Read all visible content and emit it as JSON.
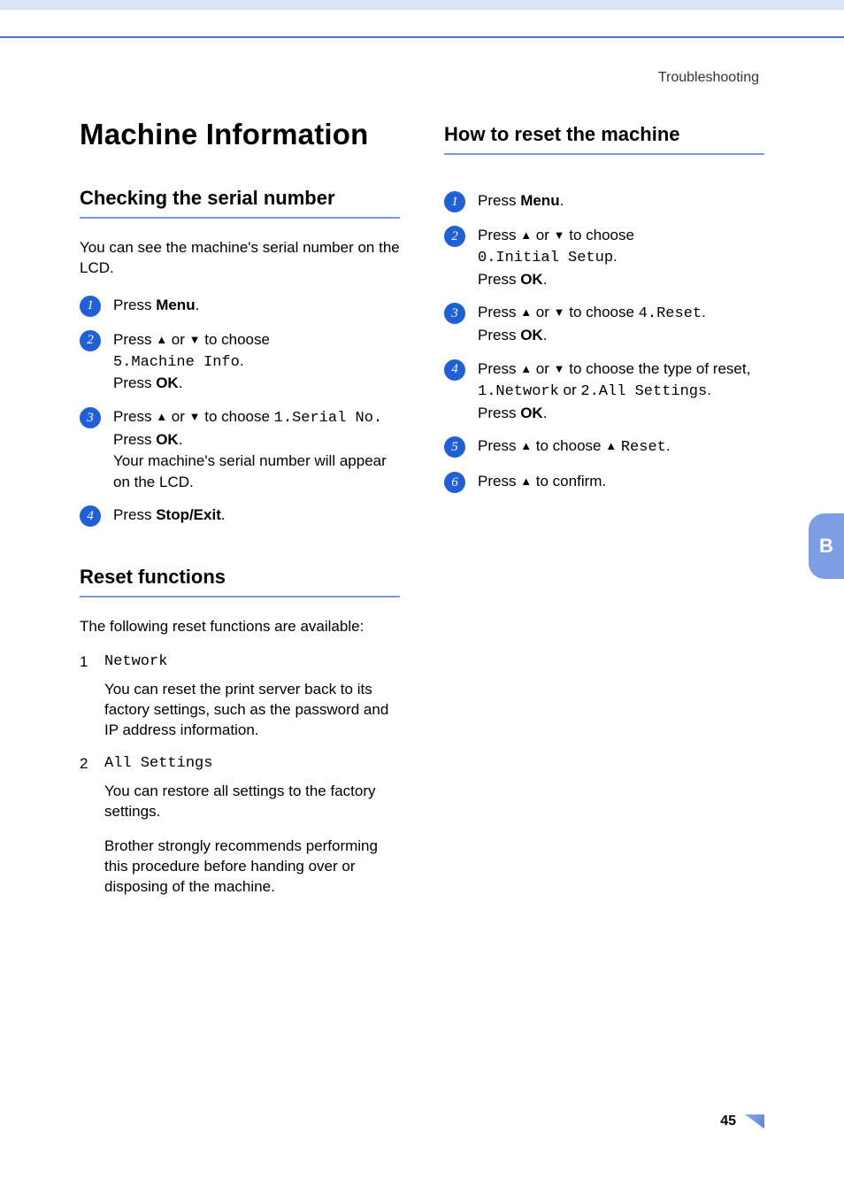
{
  "breadcrumb": "Troubleshooting",
  "page_number": "45",
  "side_tab": "B",
  "left": {
    "title": "Machine Information",
    "section1": {
      "heading": "Checking the serial number",
      "intro": "You can see the machine's serial number on the LCD.",
      "steps": {
        "s1": {
          "press": "Press ",
          "menu": "Menu",
          "dot": "."
        },
        "s2": {
          "l1a": "Press ",
          "l1b": " or ",
          "l1c": " to choose",
          "l2": "5.Machine Info",
          "l2dot": ".",
          "l3a": "Press ",
          "l3b": "OK",
          "l3c": "."
        },
        "s3": {
          "l1a": "Press ",
          "l1b": " or ",
          "l1c": " to choose ",
          "l1d": "1.Serial No.",
          "l2a": "Press ",
          "l2b": "OK",
          "l2c": ".",
          "l3": "Your machine's serial number will appear on the LCD."
        },
        "s4": {
          "a": "Press ",
          "b": "Stop/Exit",
          "c": "."
        }
      }
    },
    "section2": {
      "heading": "Reset functions",
      "intro": "The following reset functions are available:",
      "item1": {
        "num": "1",
        "label": "Network",
        "desc": "You can reset the print server back to its factory settings, such as the password and IP address information."
      },
      "item2": {
        "num": "2",
        "label": "All Settings",
        "desc1": "You can restore all settings to the factory settings.",
        "desc2": "Brother strongly recommends performing this procedure before handing over or disposing of the machine."
      }
    }
  },
  "right": {
    "heading": "How to reset the machine",
    "steps": {
      "s1": {
        "a": "Press ",
        "b": "Menu",
        "c": "."
      },
      "s2": {
        "l1a": "Press  ",
        "l1b": " or ",
        "l1c": " to choose",
        "l2": "0.Initial Setup",
        "l2dot": ".",
        "l3a": "Press ",
        "l3b": "OK",
        "l3c": "."
      },
      "s3": {
        "l1a": "Press ",
        "l1b": " or ",
        "l1c": " to choose ",
        "l1d": "4.Reset",
        "l1e": ".",
        "l2a": "Press ",
        "l2b": "OK",
        "l2c": "."
      },
      "s4": {
        "l1a": "Press ",
        "l1b": " or ",
        "l1c": " to choose the type of reset,",
        "l2a": "1.Network",
        "l2b": " or ",
        "l2c": "2.All Settings",
        "l2d": ".",
        "l3a": "Press ",
        "l3b": "OK",
        "l3c": "."
      },
      "s5": {
        "a": "Press ",
        "b": " to choose ",
        "c": " ",
        "d": "Reset",
        "e": "."
      },
      "s6": {
        "a": "Press ",
        "b": " to confirm."
      }
    }
  },
  "glyphs": {
    "up": "▲",
    "down": "▼"
  }
}
